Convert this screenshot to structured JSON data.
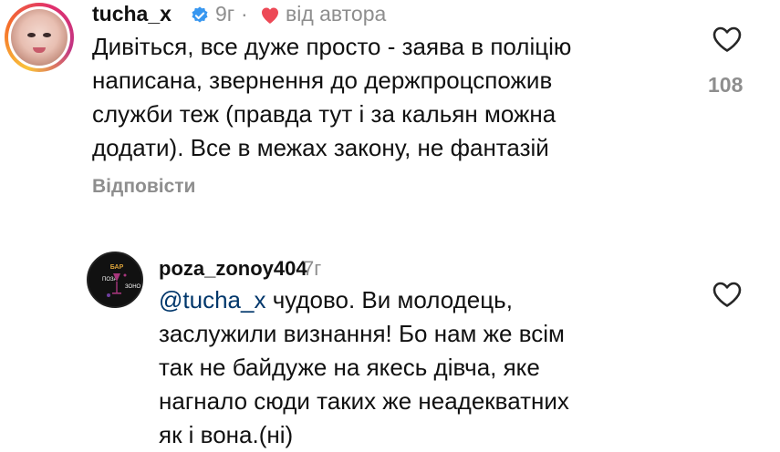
{
  "comments": [
    {
      "username": "tucha_x",
      "time": "9г",
      "author_badge": "від автора",
      "text": "Дивіться, все дуже просто - заява в поліцію\nнаписана, звернення до держпроцспожив\nслужби теж (правда тут і за кальян можна\nдодати). Все в межах закону, не фантазій",
      "reply_label": "Відповісти",
      "like_count": "108",
      "verified": true,
      "icons": {
        "verified": "verified-badge-icon",
        "heart": "heart-icon",
        "like": "heart-outline-icon"
      }
    },
    {
      "username": "poza_zonoy404",
      "time": "7г",
      "mention": "@tucha_x",
      "text_first": " чудово. Ви молодець,",
      "text_rest": "заслужили визнання! Бо нам же всім\nтак не байдуже на якесь дівча, яке\nнагнало сюди таких же неадекватних\nяк і вона.(ні)",
      "icons": {
        "like": "heart-outline-icon"
      }
    }
  ],
  "colors": {
    "verified": "#3897f0",
    "heart": "#ed4956",
    "muted": "#8e8e8e",
    "mention": "#00376b"
  }
}
